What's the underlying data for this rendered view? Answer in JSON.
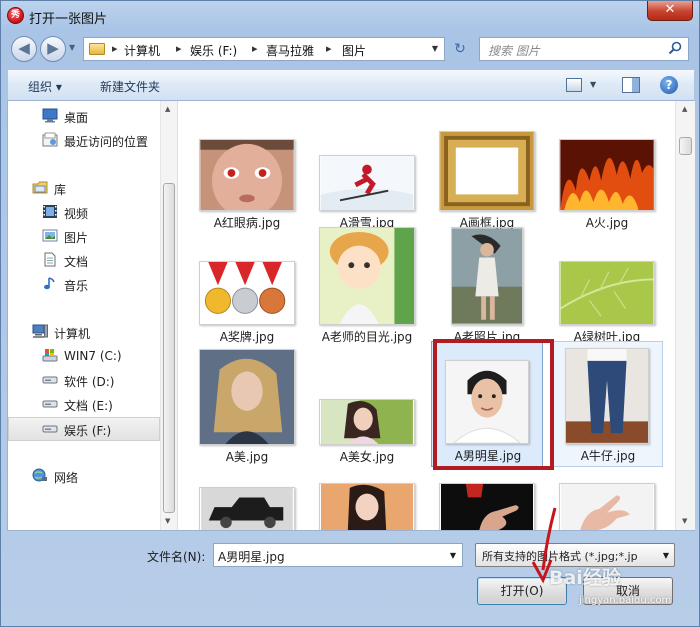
{
  "window": {
    "title": "打开一张图片",
    "app_icon_glyph": "秀",
    "close_glyph": "✕"
  },
  "nav": {
    "back_glyph": "◀",
    "forward_glyph": "▶",
    "dropdown_glyph": "▼",
    "breadcrumbs": [
      "计算机",
      "娱乐 (F:)",
      "喜马拉雅",
      "图片"
    ],
    "separator_glyph": "▸",
    "refresh_glyph": "↻",
    "search_placeholder": "搜索 图片"
  },
  "toolbar": {
    "organize_label": "组织 ▾",
    "new_folder_label": "新建文件夹",
    "view_drop_glyph": "▼",
    "help_glyph": "?"
  },
  "sidebar": {
    "items": [
      {
        "label": "桌面",
        "icon": "desktop-icon"
      },
      {
        "label": "最近访问的位置",
        "icon": "recent-places-icon"
      },
      {
        "label": "库",
        "icon": "library-icon"
      },
      {
        "label": "视频",
        "icon": "video-icon"
      },
      {
        "label": "图片",
        "icon": "pictures-icon"
      },
      {
        "label": "文档",
        "icon": "documents-icon"
      },
      {
        "label": "音乐",
        "icon": "music-icon"
      },
      {
        "label": "计算机",
        "icon": "computer-icon"
      },
      {
        "label": "WIN7 (C:)",
        "icon": "drive-c-icon"
      },
      {
        "label": "软件 (D:)",
        "icon": "drive-icon"
      },
      {
        "label": "文档 (E:)",
        "icon": "drive-icon"
      },
      {
        "label": "娱乐 (F:)",
        "icon": "drive-icon"
      },
      {
        "label": "网络",
        "icon": "network-icon"
      }
    ],
    "selected_item": "娱乐 (F:)",
    "scroll_up_glyph": "▲",
    "scroll_down_glyph": "▼"
  },
  "files": [
    {
      "name": "A红眼病.jpg"
    },
    {
      "name": "A滑雪.jpg"
    },
    {
      "name": "A画框.jpg"
    },
    {
      "name": "A火.jpg"
    },
    {
      "name": "A奖牌.jpg"
    },
    {
      "name": "A老师的目光.jpg"
    },
    {
      "name": "A老照片.jpg"
    },
    {
      "name": "A绿树叶.jpg"
    },
    {
      "name": "A美.jpg"
    },
    {
      "name": "A美女.jpg"
    },
    {
      "name": "A男明星.jpg"
    },
    {
      "name": "A牛仔.jpg"
    }
  ],
  "selected_file": "A男明星.jpg",
  "bottom": {
    "filename_label": "文件名(N):",
    "filename_value": "A男明星.jpg",
    "filter_value": "所有支持的图片格式 (*.jpg;*.jp",
    "dropdown_glyph": "▼",
    "open_button": "打开(O)",
    "cancel_button": "取消"
  },
  "watermark": {
    "text": "Bai经验",
    "sub": "jingyan.baidu.com"
  },
  "colors": {
    "highlight_border": "#b11c22",
    "selection_bg": "#dcebfc",
    "frame": "#bcd3ee"
  }
}
